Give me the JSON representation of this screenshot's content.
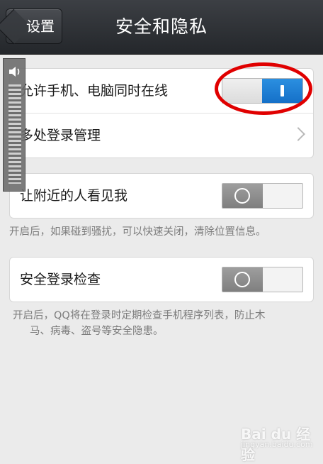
{
  "header": {
    "back_label": "设置",
    "title": "安全和隐私"
  },
  "group1": {
    "rows": [
      {
        "label": "允许手机、电脑同时在线",
        "control": "toggle",
        "state": "on"
      },
      {
        "label": "多处登录管理",
        "control": "chevron"
      }
    ]
  },
  "group2": {
    "row": {
      "label": "让附近的人看见我",
      "control": "toggle",
      "state": "off"
    },
    "hint": "开启后，如果碰到骚扰，可以快速关闭，清除位置信息。"
  },
  "group3": {
    "row": {
      "label": "安全登录检查",
      "control": "toggle",
      "state": "off"
    },
    "hint_line1": "开启后，QQ将在登录时定期检查手机程序列表，防止木",
    "hint_line2": "马、病毒、盗号等安全隐患。"
  },
  "overlays": {
    "volume_icon": "speaker-icon",
    "watermark": "Bai du 经验",
    "watermark_url": "jingyan.baidu.com",
    "highlight_color": "#e00000",
    "toggle_on_color": "#1d7fd6",
    "toggle_off_color": "#8a8a8a"
  }
}
